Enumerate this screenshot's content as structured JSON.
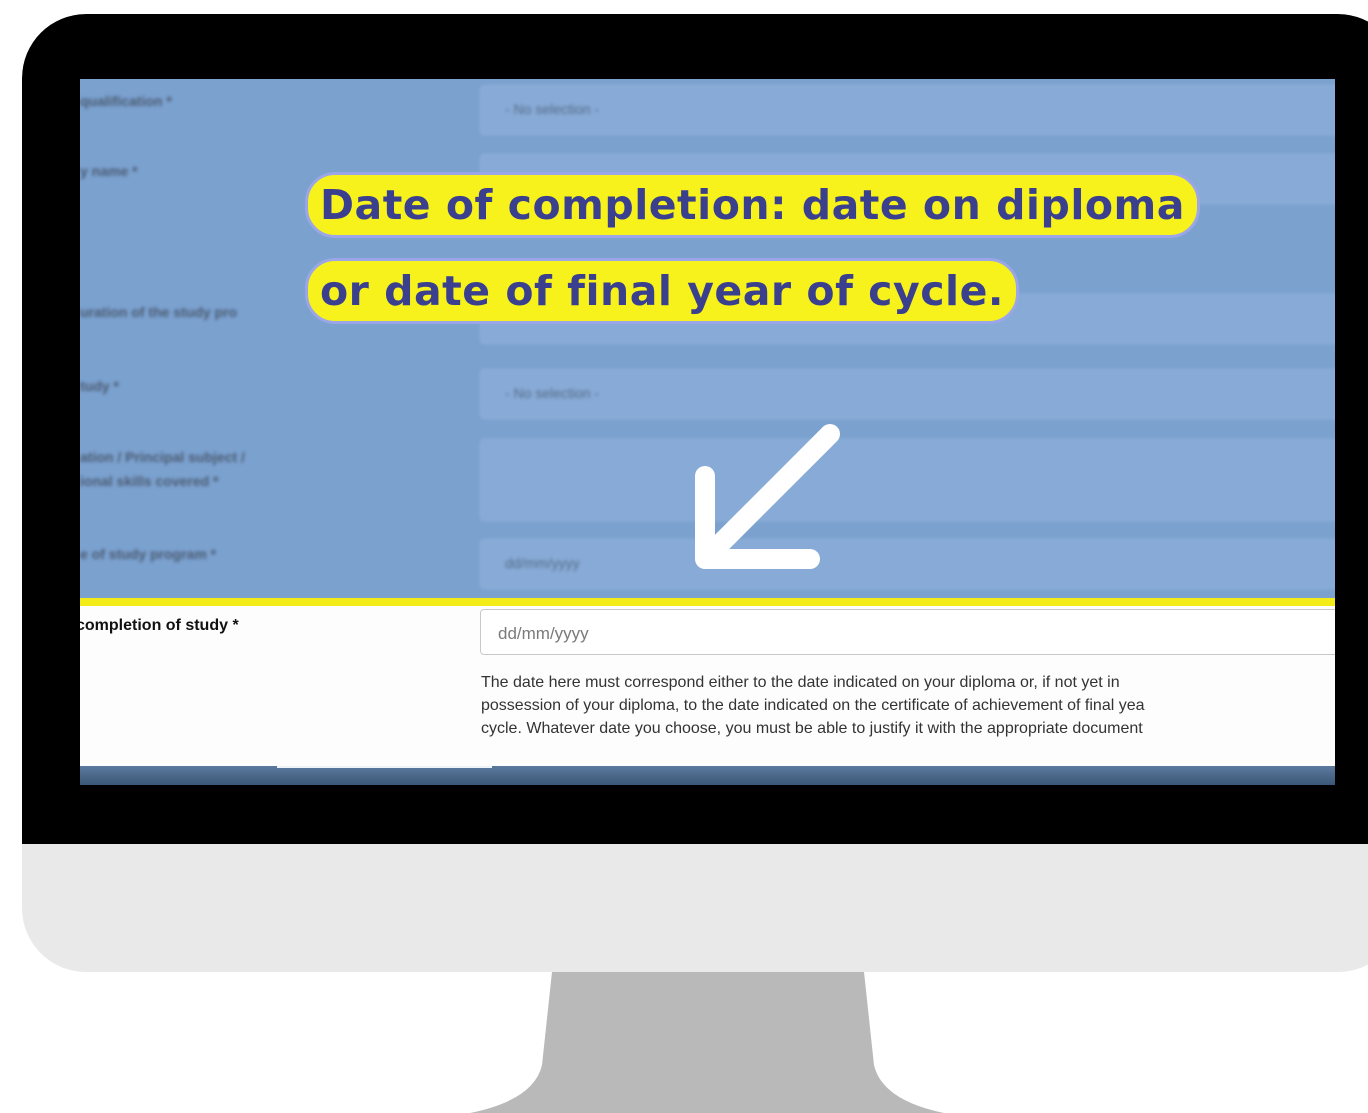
{
  "background_fields": [
    {
      "label": "qualification *",
      "value": "- No selection -"
    },
    {
      "label": "y name *",
      "value": ""
    },
    {
      "label": "uration of the study pro",
      "value": ""
    },
    {
      "label": "tudy *",
      "value": "- No selection -"
    },
    {
      "label_line1": "ation / Principal subject /",
      "label_line2": "ional skills covered *",
      "value": ""
    },
    {
      "label": "e of study program *",
      "value": "dd/mm/yyyy"
    }
  ],
  "callout": {
    "line1": "Date of completion: date on diploma",
    "line2": "or date of final year of cycle."
  },
  "arrow_icon": "arrow-down-left-icon",
  "highlighted_field": {
    "label": "completion of study *",
    "placeholder": "dd/mm/yyyy",
    "help_lines": [
      "The date here must correspond either to the date indicated on your diploma or, if not yet in",
      "possession of your diploma, to the date indicated on the certificate of achievement of final yea",
      "cycle. Whatever date you choose, you must be able to justify it with the appropriate document"
    ]
  },
  "colors": {
    "screen_bg": "#7ba1cf",
    "callout_bg": "#f7f21c",
    "callout_text": "#3a3f8e",
    "highlight_border": "#f3ec18"
  }
}
